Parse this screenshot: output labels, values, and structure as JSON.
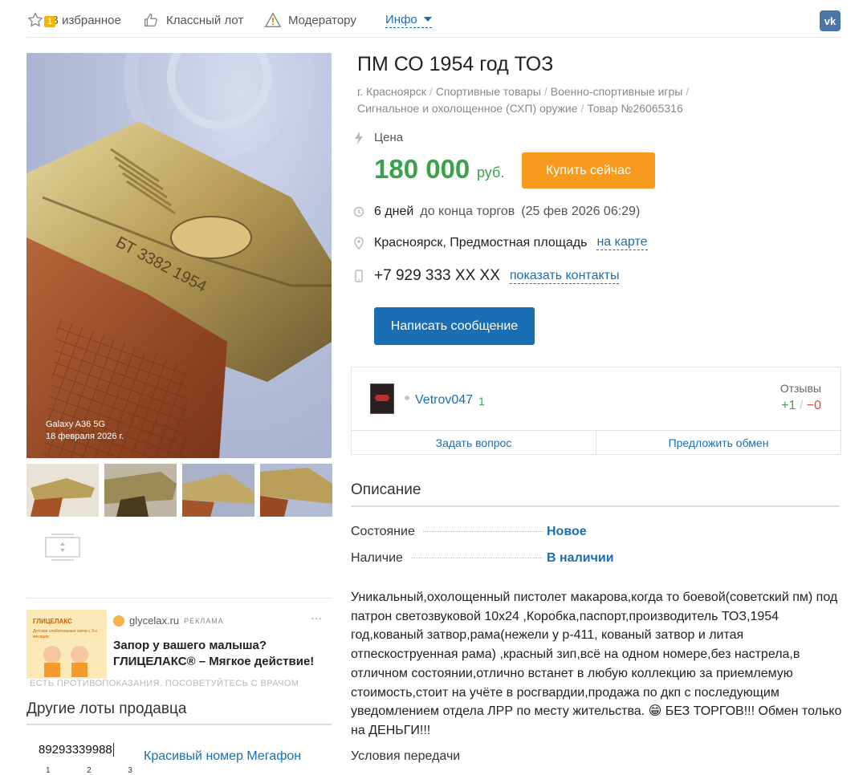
{
  "topbar": {
    "favorites_badge": "1",
    "favorites_label": "В избранное",
    "like_label": "Классный лот",
    "moderator_label": "Модератору",
    "info_label": "Инфо"
  },
  "photo": {
    "watermark_line1": "Galaxy A36 5G",
    "watermark_line2": "18 февраля 2026 г.",
    "engraving": "БТ 3382 1954"
  },
  "listing": {
    "title": "ПМ СО 1954 год ТОЗ",
    "breadcrumbs": [
      "г. Красноярск",
      "Спортивные товары",
      "Военно-спортивные игры",
      "Сигнальное и охолощенное (СХП) оружие",
      "Товар №26065316"
    ],
    "price_label": "Цена",
    "price": "180 000",
    "currency": "руб.",
    "buy_button": "Купить сейчас",
    "time_left": "6 дней",
    "time_left_suffix": "до конца торгов",
    "end_date": "(25 фев 2026 06:29)",
    "location": "Красноярск, Предмостная площадь",
    "map_link": "на карте",
    "phone": "+7 929 333 XX XX",
    "show_contacts": "показать контакты",
    "message_button": "Написать сообщение"
  },
  "seller": {
    "name": "Vetrov047",
    "rating": "1",
    "reviews_label": "Отзывы",
    "reviews_pos": "+1",
    "reviews_sep": "/",
    "reviews_neg": "−0",
    "ask_question": "Задать вопрос",
    "offer_exchange": "Предложить обмен"
  },
  "description": {
    "heading": "Описание",
    "condition_label": "Состояние",
    "condition_value": "Новое",
    "availability_label": "Наличие",
    "availability_value": "В наличии",
    "text": "Уникальный,охолощенный пистолет макарова,когда то боевой(советский пм) под патрон светозвуковой 10х24 ,Коробка,паспорт,производитель ТОЗ,1954 год,кованый затвор,рама(нежели у р-411, кованый затвор и литая отпескоструенная рама) ,красный зип,всё на одном номере,без настрела,в отличном состоянии,отлично встанет в любую коллекцию за приемлемую стоимость,стоит на учёте в росгвардии,продажа по дкп с последующим уведомлением отдела ЛРР по месту жительства. 😁 БЕЗ ТОРГОВ!!! Обмен только на ДЕНЬГИ!!!",
    "transfer_heading": "Условия передачи"
  },
  "ad": {
    "brand_image_text": "ГЛИЦЕЛАКС",
    "image_subtext": "Детские слабительные свечи с 3-х месяцев",
    "domain": "glycelax.ru",
    "tag": "РЕКЛАМА",
    "line1": "Запор у вашего малыша?",
    "line2": "ГЛИЦЕЛАКС® – Мягкое действие!",
    "disclaimer": "ЕСТЬ ПРОТИВОПОКАЗАНИЯ. ПОСОВЕТУЙТЕСЬ С ВРАЧОМ"
  },
  "other_lots": {
    "heading": "Другие лоты продавца",
    "item_number": "89293339988",
    "item_title": "Красивый номер Мегафон",
    "keypad_digits": "1  2  3"
  },
  "colors": {
    "accent_blue": "#1a6eb3",
    "price_green": "#3aa34a",
    "buy_orange": "#f79a1d",
    "negative_red": "#e04a3a"
  }
}
